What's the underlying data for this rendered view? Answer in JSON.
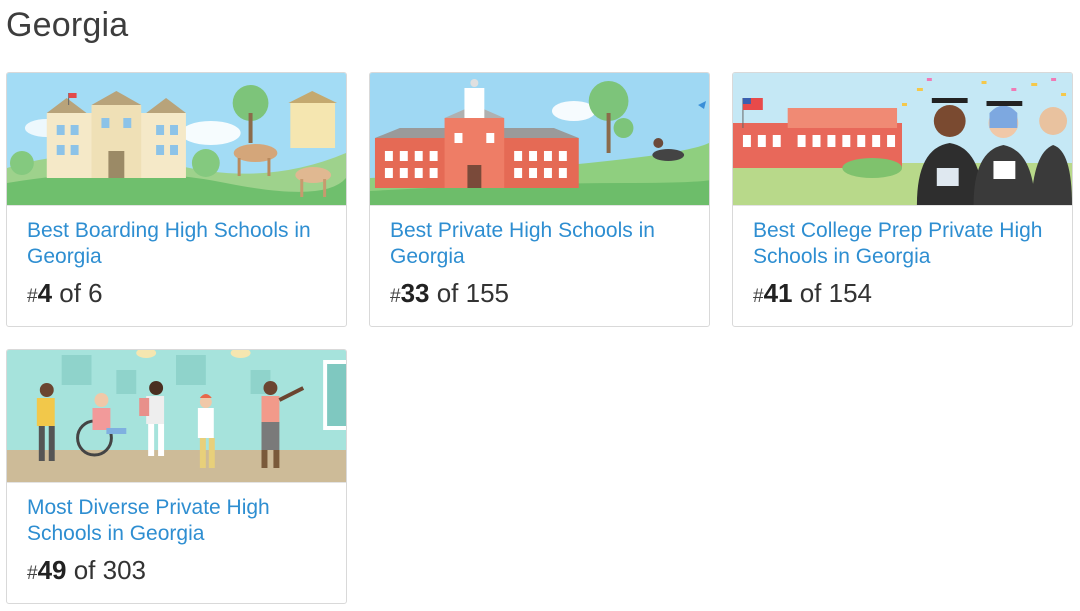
{
  "section": {
    "title": "Georgia"
  },
  "cards": [
    {
      "illustration": "boarding-school-campus-with-horses",
      "title": "Best Boarding High Schools in Georgia",
      "rank_hash": "#",
      "rank": "4",
      "rank_suffix": " of 6"
    },
    {
      "illustration": "private-school-brick-building",
      "title": "Best Private High Schools in Georgia",
      "rank_hash": "#",
      "rank": "33",
      "rank_suffix": " of 155"
    },
    {
      "illustration": "graduates-in-caps-with-confetti",
      "title": "Best College Prep Private High Schools in Georgia",
      "rank_hash": "#",
      "rank": "41",
      "rank_suffix": " of 154"
    },
    {
      "illustration": "diverse-students-in-hallway",
      "title": "Most Diverse Private High Schools in Georgia",
      "rank_hash": "#",
      "rank": "49",
      "rank_suffix": " of 303"
    }
  ],
  "colors": {
    "link": "#2e8ed1",
    "sky": "#8fd0f0",
    "grass": "#7cc47a",
    "hallway": "#9fded8"
  }
}
